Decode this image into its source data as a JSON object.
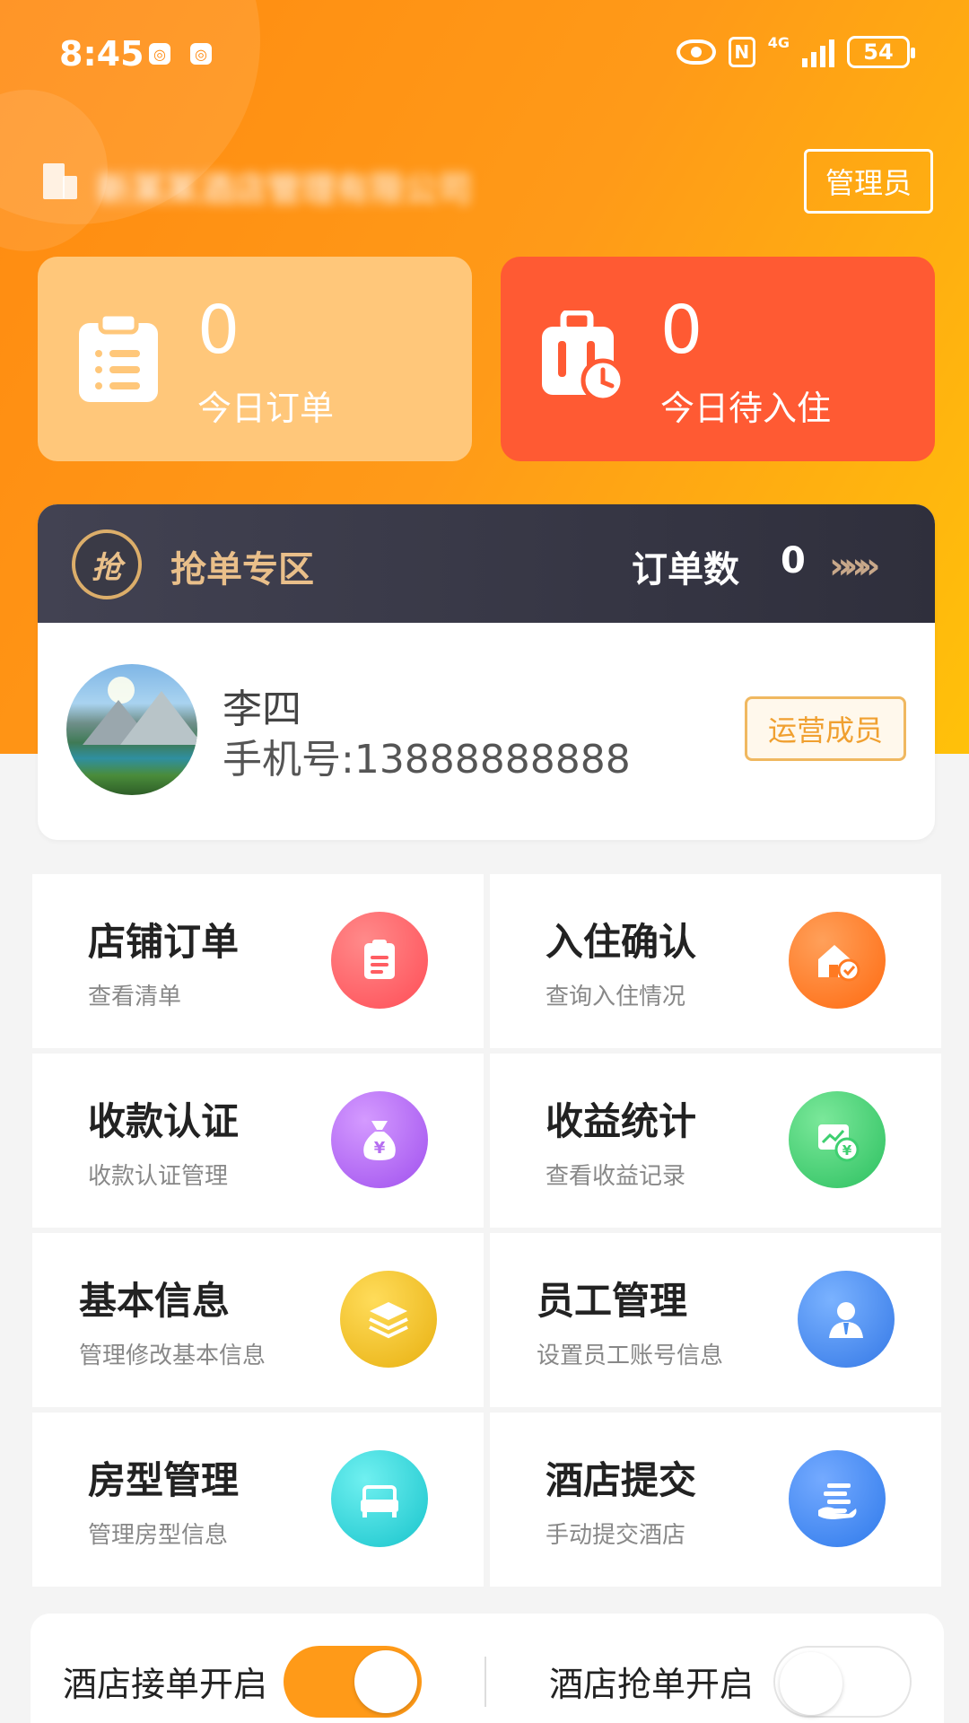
{
  "status_bar": {
    "time": "8:45",
    "network": "4G",
    "battery": "54"
  },
  "header": {
    "hotel_name": "新某某酒店管理有限公司",
    "role_badge": "管理员"
  },
  "stats": [
    {
      "value": "0",
      "label": "今日订单",
      "icon": "clipboard-icon"
    },
    {
      "value": "0",
      "label": "今日待入住",
      "icon": "luggage-clock-icon"
    }
  ],
  "grab_zone": {
    "logo_text": "抢",
    "title": "抢单专区",
    "count_label": "订单数",
    "count_value": "0",
    "arrows": "»»»"
  },
  "user": {
    "name": "李四",
    "phone": "手机号:13888888888",
    "role": "运营成员"
  },
  "menu": [
    {
      "title": "店铺订单",
      "subtitle": "查看清单",
      "icon": "order-list-icon",
      "color": "#ff5d62"
    },
    {
      "title": "入住确认",
      "subtitle": "查询入住情况",
      "icon": "house-check-icon",
      "color": "#ff7a22"
    },
    {
      "title": "收款认证",
      "subtitle": "收款认证管理",
      "icon": "money-bag-icon",
      "color": "#b56ef0"
    },
    {
      "title": "收益统计",
      "subtitle": "查看收益记录",
      "icon": "income-chart-icon",
      "color": "#3ecf70"
    },
    {
      "title": "基本信息",
      "subtitle": "管理修改基本信息",
      "icon": "layers-icon",
      "color": "#f0c020"
    },
    {
      "title": "员工管理",
      "subtitle": "设置员工账号信息",
      "icon": "staff-icon",
      "color": "#4a8ff0"
    },
    {
      "title": "房型管理",
      "subtitle": "管理房型信息",
      "icon": "bed-icon",
      "color": "#2cd4d4"
    },
    {
      "title": "酒店提交",
      "subtitle": "手动提交酒店",
      "icon": "hand-submit-icon",
      "color": "#3f8ef5"
    }
  ],
  "toggles": [
    {
      "label": "酒店接单开启",
      "state": "on"
    },
    {
      "label": "酒店抢单开启",
      "state": "off"
    }
  ]
}
